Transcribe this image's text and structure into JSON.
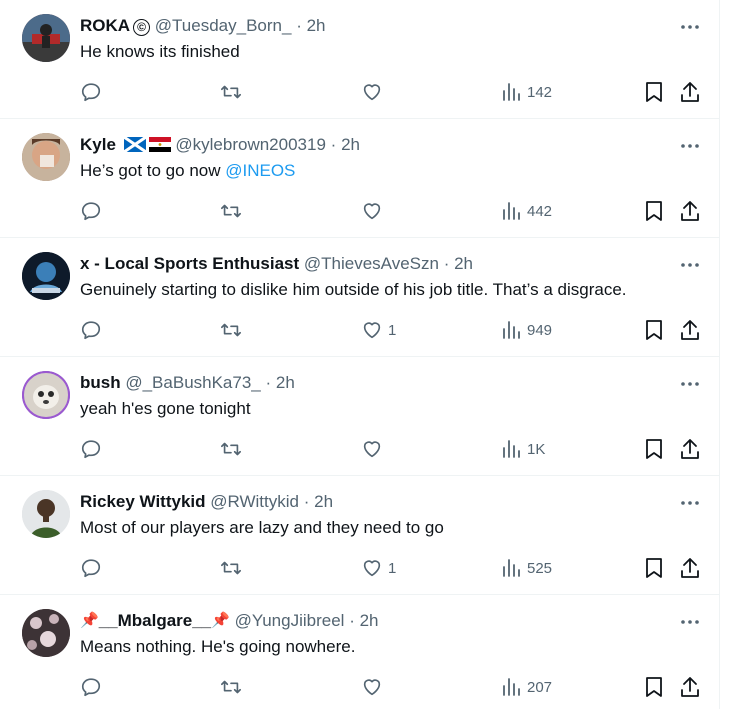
{
  "replies": [
    {
      "name": "ROKA",
      "name_suffix": "©",
      "handle": "@Tuesday_Born_",
      "time": "2h",
      "text": "He knows its finished",
      "mention": "",
      "replies_count": "",
      "retweets_count": "",
      "likes_count": "",
      "views_count": "142",
      "avatar_color": "#6a2a2a"
    },
    {
      "name": "Kyle",
      "handle": "@kylebrown200319",
      "time": "2h",
      "text": "He’s got to go now ",
      "mention": "@INEOS",
      "replies_count": "",
      "retweets_count": "",
      "likes_count": "",
      "views_count": "442",
      "avatar_color": "#9c7a63",
      "flags": [
        "scotland-flag-icon",
        "egypt-flag-icon"
      ]
    },
    {
      "name": "x - Local Sports Enthusiast",
      "handle": "@ThievesAveSzn",
      "time": "2h",
      "text": "Genuinely starting to dislike him outside of his job title. That’s a disgrace.",
      "mention": "",
      "replies_count": "",
      "retweets_count": "",
      "likes_count": "1",
      "views_count": "949",
      "avatar_color": "#1c2a3a"
    },
    {
      "name": "bush",
      "handle": "@_BaBushKa73_",
      "time": "2h",
      "text": "yeah h'es gone tonight",
      "mention": "",
      "replies_count": "",
      "retweets_count": "",
      "likes_count": "",
      "views_count": "1K",
      "avatar_color": "#c9c3bb"
    },
    {
      "name": "Rickey Wittykid",
      "handle": "@RWittykid",
      "time": "2h",
      "text": "Most of our players are lazy and they need to go",
      "mention": "",
      "replies_count": "",
      "retweets_count": "",
      "likes_count": "1",
      "views_count": "525",
      "avatar_color": "#d9dde0"
    },
    {
      "name": "__Mbalgare__",
      "name_prefix": "📌",
      "name_suffix": "📌",
      "handle": "@YungJiibreel",
      "time": "2h",
      "text": "Means nothing. He's going nowhere.",
      "mention": "",
      "replies_count": "",
      "retweets_count": "",
      "likes_count": "",
      "views_count": "207",
      "avatar_color": "#4a3b3e"
    }
  ],
  "separator": "·",
  "colors": {
    "text": "#0f1419",
    "secondary": "#536471",
    "link": "#1d9bf0",
    "border": "#eff3f4"
  },
  "icons": [
    "reply-icon",
    "retweet-icon",
    "like-icon",
    "views-icon",
    "bookmark-icon",
    "share-icon",
    "more-icon"
  ]
}
